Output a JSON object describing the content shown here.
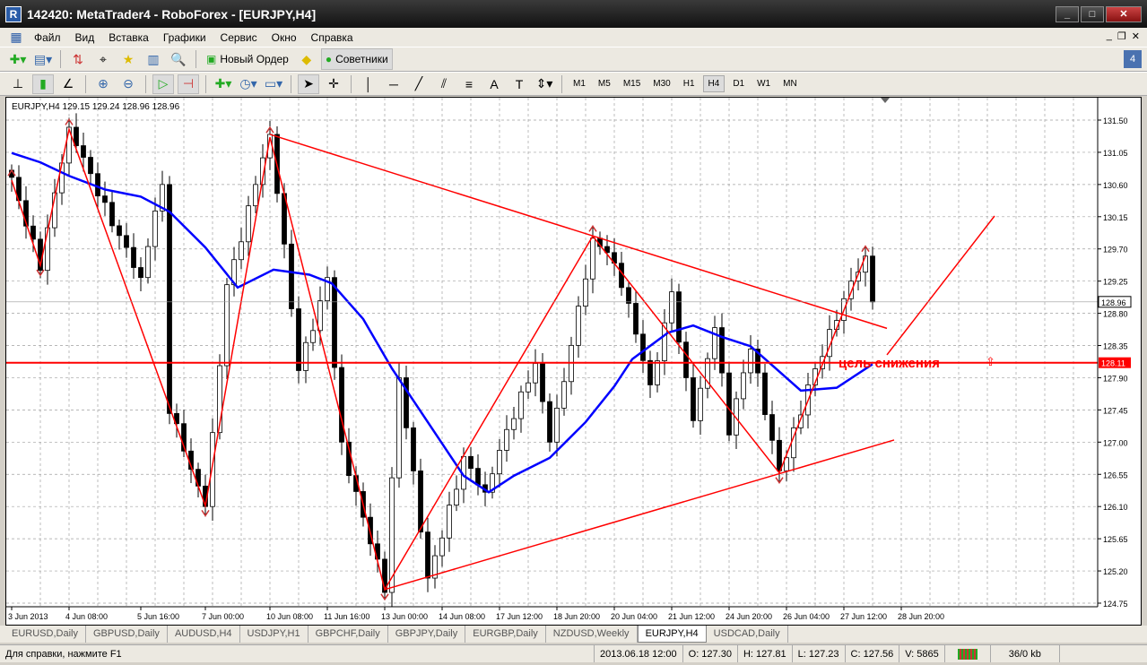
{
  "window": {
    "title": "142420: MetaTrader4 - RoboForex - [EURJPY,H4]",
    "min": "_",
    "max": "□",
    "close": "✕"
  },
  "menu": [
    "Файл",
    "Вид",
    "Вставка",
    "Графики",
    "Сервис",
    "Окно",
    "Справка"
  ],
  "toolbar": {
    "new_order": "Новый Ордер",
    "experts": "Советники"
  },
  "timeframes": [
    "M1",
    "M5",
    "M15",
    "M30",
    "H1",
    "H4",
    "D1",
    "W1",
    "MN"
  ],
  "active_timeframe": "H4",
  "chart": {
    "header": "EURJPY,H4  129.15 129.24 128.96 128.96",
    "annotation": "цель снижения",
    "current_price": "128.96",
    "level_price": "128.11",
    "colors": {
      "bull": "#ffffff",
      "bear": "#000000",
      "ma": "#0000ff",
      "lines": "#ff0000",
      "grid": "#a0a0a0"
    }
  },
  "chart_data": {
    "type": "candlestick",
    "symbol": "EURJPY",
    "timeframe": "H4",
    "ylim": [
      124.55,
      131.85
    ],
    "yticks": [
      "131.50",
      "131.05",
      "130.60",
      "130.15",
      "129.70",
      "129.25",
      "128.80",
      "128.35",
      "127.90",
      "127.45",
      "127.00",
      "126.55",
      "126.10",
      "125.65",
      "125.20",
      "124.75"
    ],
    "xticks": [
      {
        "bar": 0,
        "label": "3 Jun 2013"
      },
      {
        "bar": 8,
        "label": "4 Jun 08:00"
      },
      {
        "bar": 18,
        "label": "5 Jun 16:00"
      },
      {
        "bar": 27,
        "label": "7 Jun 00:00"
      },
      {
        "bar": 36,
        "label": "10 Jun 08:00"
      },
      {
        "bar": 44,
        "label": "11 Jun 16:00"
      },
      {
        "bar": 52,
        "label": "13 Jun 00:00"
      },
      {
        "bar": 60,
        "label": "14 Jun 08:00"
      },
      {
        "bar": 68,
        "label": "17 Jun 12:00"
      },
      {
        "bar": 76,
        "label": "18 Jun 20:00"
      },
      {
        "bar": 84,
        "label": "20 Jun 04:00"
      },
      {
        "bar": 92,
        "label": "21 Jun 12:00"
      },
      {
        "bar": 100,
        "label": "24 Jun 20:00"
      },
      {
        "bar": 108,
        "label": "26 Jun 04:00"
      },
      {
        "bar": 116,
        "label": "27 Jun 12:00"
      },
      {
        "bar": 124,
        "label": "28 Jun 20:00"
      }
    ],
    "close_path": [
      [
        0,
        130.7
      ],
      [
        4,
        129.4
      ],
      [
        8,
        131.4
      ],
      [
        18,
        129.3
      ],
      [
        21,
        130.6
      ],
      [
        22,
        127.4
      ],
      [
        27,
        126.1
      ],
      [
        30,
        129.2
      ],
      [
        36,
        131.3
      ],
      [
        40,
        128.0
      ],
      [
        44,
        129.3
      ],
      [
        46,
        127.0
      ],
      [
        52,
        124.9
      ],
      [
        54,
        127.9
      ],
      [
        58,
        125.1
      ],
      [
        63,
        126.8
      ],
      [
        66,
        126.3
      ],
      [
        73,
        128.1
      ],
      [
        75,
        127.0
      ],
      [
        81,
        129.85
      ],
      [
        84,
        129.5
      ],
      [
        89,
        127.8
      ],
      [
        92,
        129.1
      ],
      [
        95,
        127.3
      ],
      [
        98,
        128.6
      ],
      [
        100,
        127.1
      ],
      [
        103,
        128.3
      ],
      [
        107,
        126.6
      ],
      [
        111,
        127.8
      ],
      [
        119,
        129.6
      ],
      [
        120,
        128.96
      ]
    ],
    "moving_average": [
      [
        0,
        131.04
      ],
      [
        4,
        130.91
      ],
      [
        8,
        130.72
      ],
      [
        13,
        130.53
      ],
      [
        18,
        130.43
      ],
      [
        22,
        130.22
      ],
      [
        27,
        129.72
      ],
      [
        31.5,
        129.16
      ],
      [
        36.5,
        129.41
      ],
      [
        41.5,
        129.34
      ],
      [
        44.6,
        129.22
      ],
      [
        49,
        128.72
      ],
      [
        53,
        128.03
      ],
      [
        58,
        127.28
      ],
      [
        63,
        126.53
      ],
      [
        66.5,
        126.3
      ],
      [
        70,
        126.53
      ],
      [
        75,
        126.78
      ],
      [
        80,
        127.28
      ],
      [
        84,
        127.78
      ],
      [
        86.5,
        128.16
      ],
      [
        91.5,
        128.53
      ],
      [
        95,
        128.63
      ],
      [
        99,
        128.47
      ],
      [
        103,
        128.34
      ],
      [
        106.5,
        128.03
      ],
      [
        110,
        127.72
      ],
      [
        115,
        127.76
      ],
      [
        120,
        128.09
      ]
    ],
    "zigzag": [
      [
        0,
        130.66
      ],
      [
        4,
        129.47
      ],
      [
        8,
        131.37
      ],
      [
        27,
        126.11
      ],
      [
        36,
        131.26
      ],
      [
        52,
        124.94
      ],
      [
        81,
        129.88
      ],
      [
        107,
        126.57
      ],
      [
        119,
        129.6
      ]
    ],
    "trendlines": [
      [
        [
          36,
          131.3
        ],
        [
          122,
          128.59
        ]
      ],
      [
        [
          52,
          124.94
        ],
        [
          123,
          127.03
        ]
      ],
      [
        [
          122,
          128.22
        ],
        [
          137,
          130.16
        ]
      ]
    ],
    "horizontal_level": 128.11
  },
  "tabs": [
    "EURUSD,Daily",
    "GBPUSD,Daily",
    "AUDUSD,H4",
    "USDJPY,H1",
    "GBPCHF,Daily",
    "GBPJPY,Daily",
    "EURGBP,Daily",
    "NZDUSD,Weekly",
    "EURJPY,H4",
    "USDCAD,Daily"
  ],
  "active_tab": "EURJPY,H4",
  "status": {
    "help": "Для справки, нажмите F1",
    "time": "2013.06.18 12:00",
    "open": "O: 127.30",
    "high": "H: 127.81",
    "low": "L: 127.23",
    "close": "C: 127.56",
    "volume": "V: 5865",
    "traffic": "36/0 kb"
  }
}
